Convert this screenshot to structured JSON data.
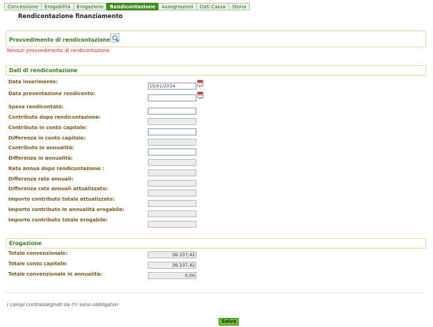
{
  "tabs": [
    {
      "label": "Concessione",
      "active": false
    },
    {
      "label": "Erogabilità",
      "active": false
    },
    {
      "label": "Erogazione",
      "active": false
    },
    {
      "label": "Rendicontazione",
      "active": true
    },
    {
      "label": "Assegnazioni",
      "active": false
    },
    {
      "label": "Dati Cassa",
      "active": false
    },
    {
      "label": "Storia",
      "active": false
    }
  ],
  "page_title": "Rendicontazione finanziamento",
  "provvedimento": {
    "title": "Provvedimento di rendicontazione (*)",
    "error": "Nessun provvedimento di rendicontazione"
  },
  "dati": {
    "title": "Dati di rendicontazione",
    "fields": [
      {
        "label": "Data inserimento:",
        "value": "15/01/2014",
        "editable": true,
        "calendar": true
      },
      {
        "label": "Data presentazione rendiconto:",
        "value": "",
        "editable": true,
        "calendar": true
      },
      {
        "label": "Spesa rendicontata:",
        "value": "",
        "editable": true
      },
      {
        "label": "Contributo dopo rendicontazione:",
        "value": "",
        "editable": false
      },
      {
        "label": "Contributo in conto capitale:",
        "value": "",
        "editable": true
      },
      {
        "label": "Differenza in conto capitale:",
        "value": "",
        "editable": false
      },
      {
        "label": "Contributo in annualità:",
        "value": "",
        "editable": true
      },
      {
        "label": "Differenza in annualità:",
        "value": "",
        "editable": false
      },
      {
        "label": "Rata annua dopo rendicontazione :",
        "value": "",
        "editable": false
      },
      {
        "label": "Differenza rate annuali:",
        "value": "",
        "editable": false
      },
      {
        "label": "Differenza rate annuali attualizzato:",
        "value": "",
        "editable": false
      },
      {
        "label": "Importo contributo totale attualizzato:",
        "value": "",
        "editable": false
      },
      {
        "label": "Importo contributo in annualità erogabile:",
        "value": "",
        "editable": false
      },
      {
        "label": "Importo contributo totale erogabile:",
        "value": "",
        "editable": false
      }
    ]
  },
  "erogazione": {
    "title": "Erogazione",
    "fields": [
      {
        "label": "Totale convenzionale:",
        "value": "36.337,42"
      },
      {
        "label": "Totale conto capitale:",
        "value": "36.337,42"
      },
      {
        "label": "Totale convenzionale in annualità:",
        "value": "0,00"
      }
    ]
  },
  "note": "I campi contrassegnati da (*) sono obbligatori",
  "save_label": "Salva"
}
